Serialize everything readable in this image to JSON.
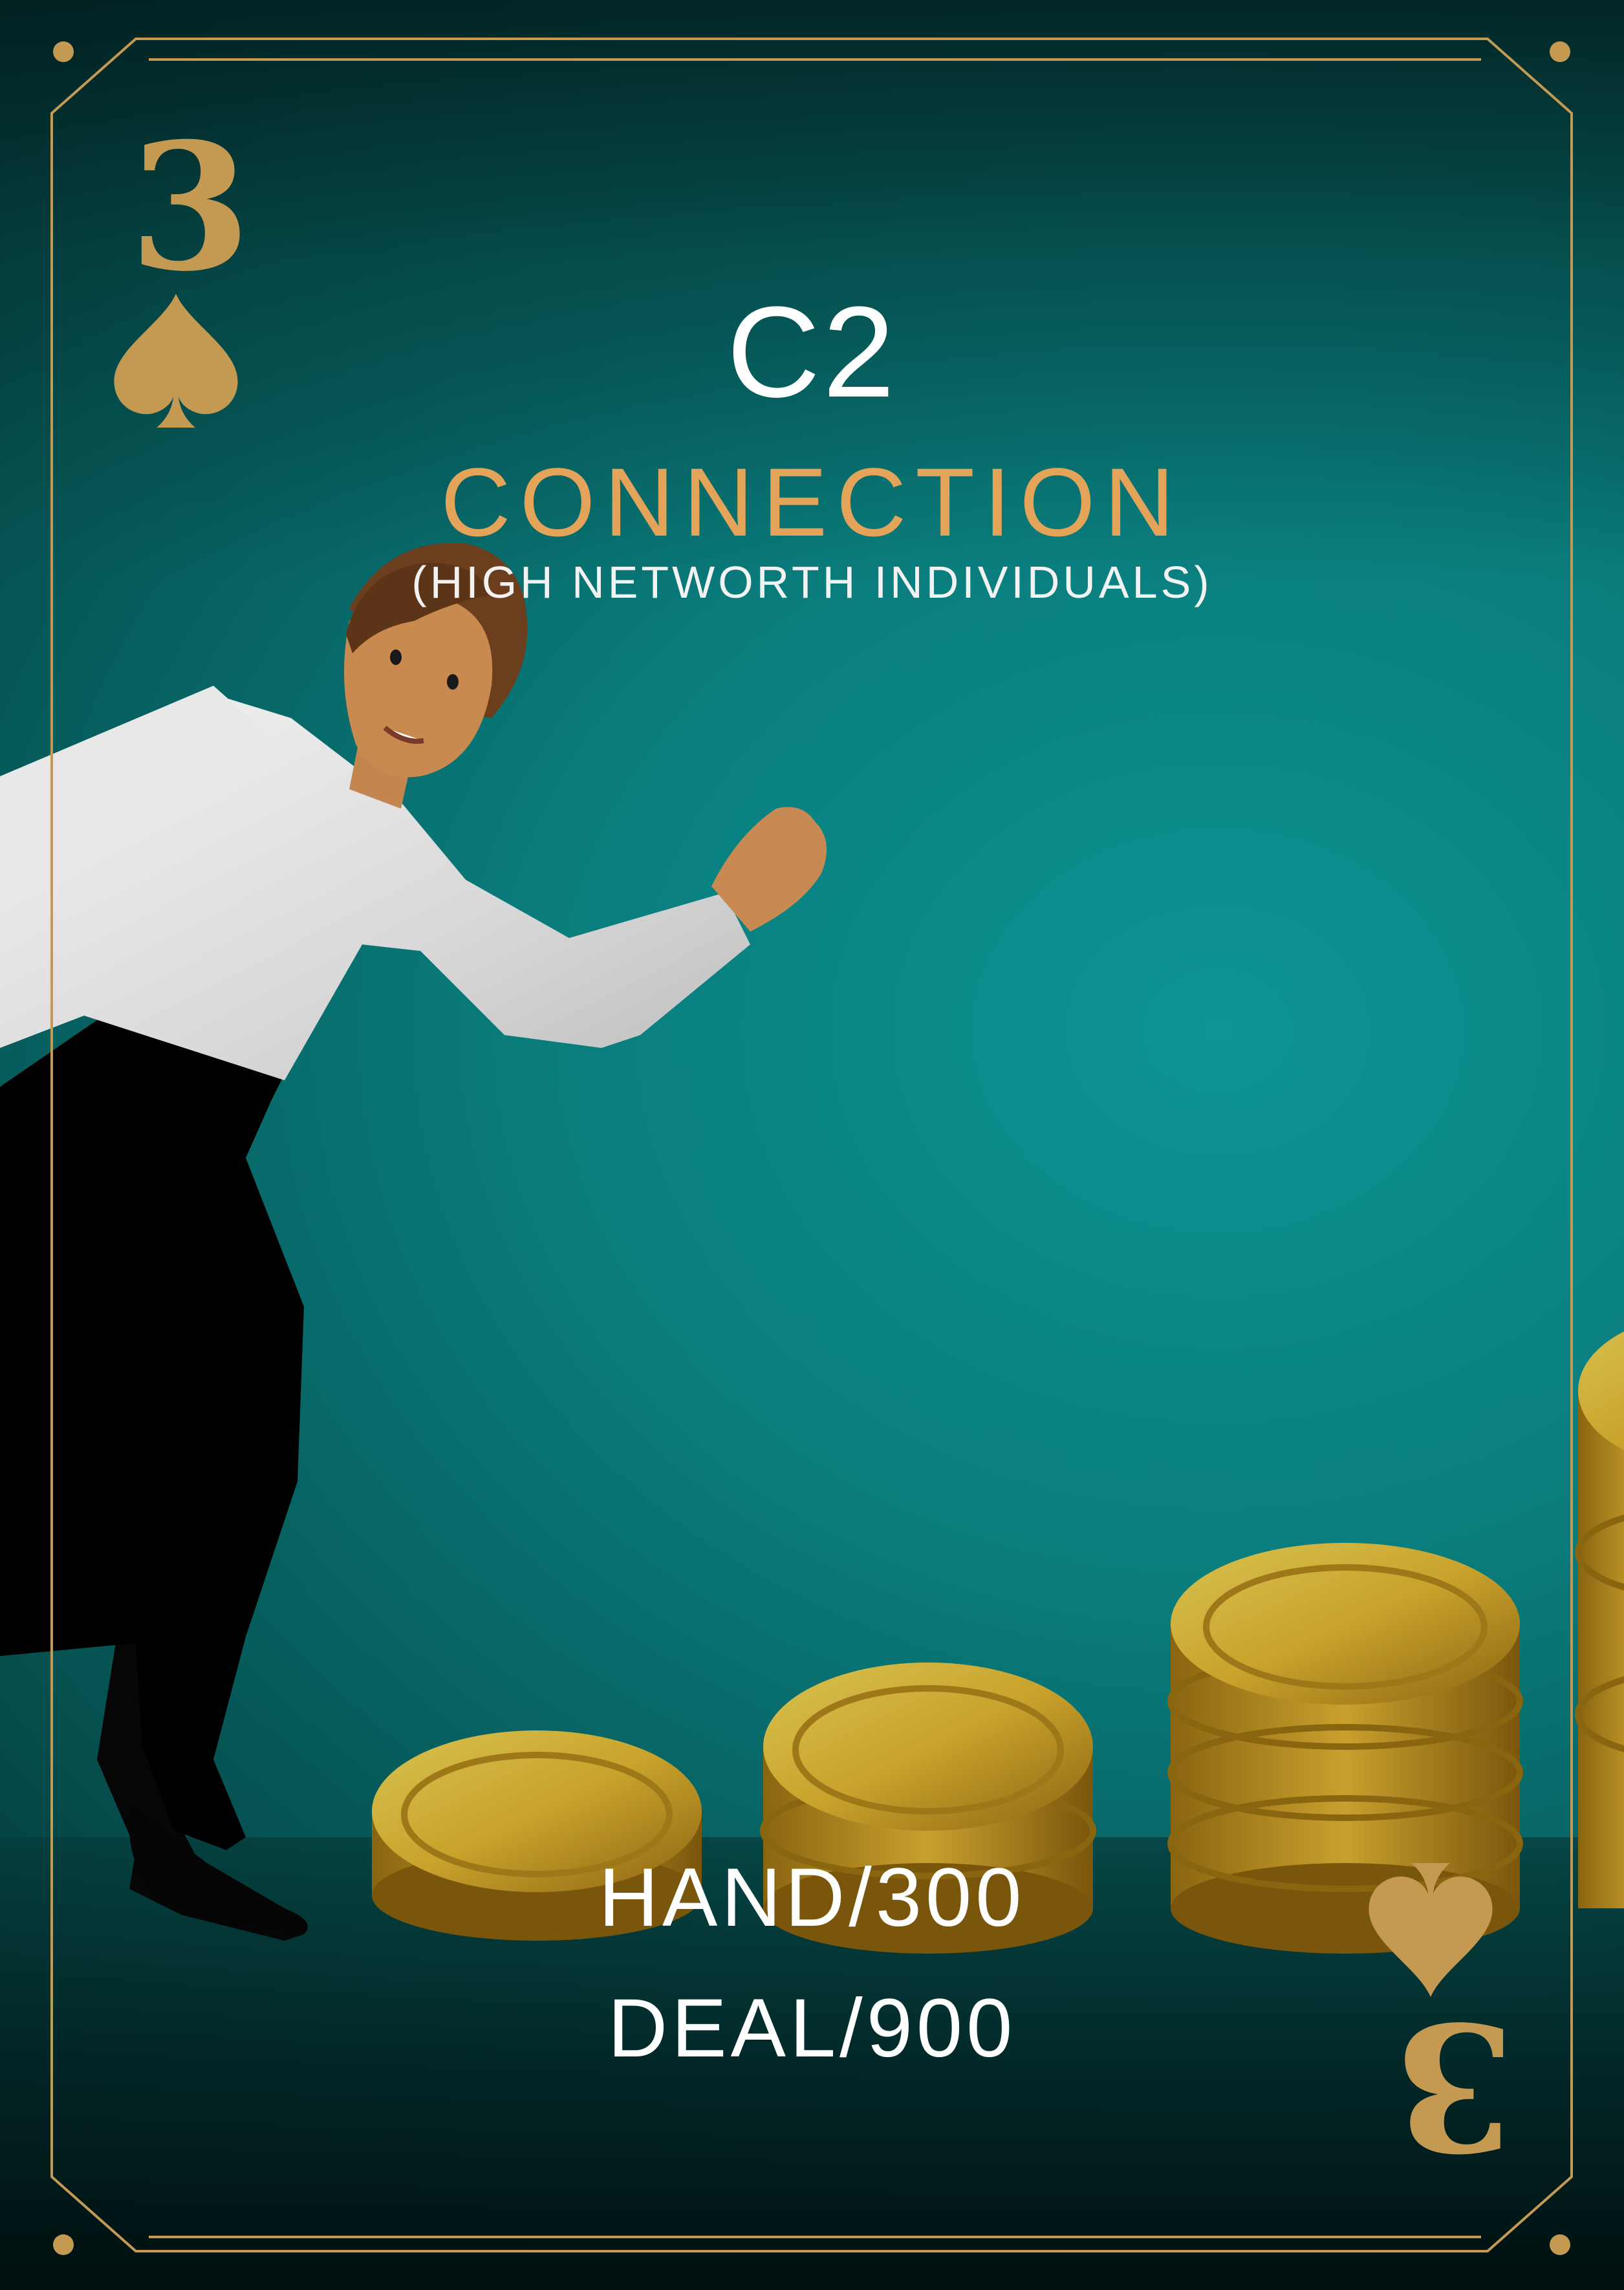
{
  "card": {
    "rank": "3",
    "suit_icon": "spade-icon",
    "code": "C2",
    "category": "CONNECTION",
    "description": "(HIGH NETWORTH INDIVIDUALS)",
    "hand_value": "HAND/300",
    "deal_value": "DEAL/900"
  },
  "colors": {
    "gold": "#c49a53",
    "category_orange": "#e3a45a",
    "background_teal": "#0a7c7c",
    "text_white": "#ffffff"
  }
}
